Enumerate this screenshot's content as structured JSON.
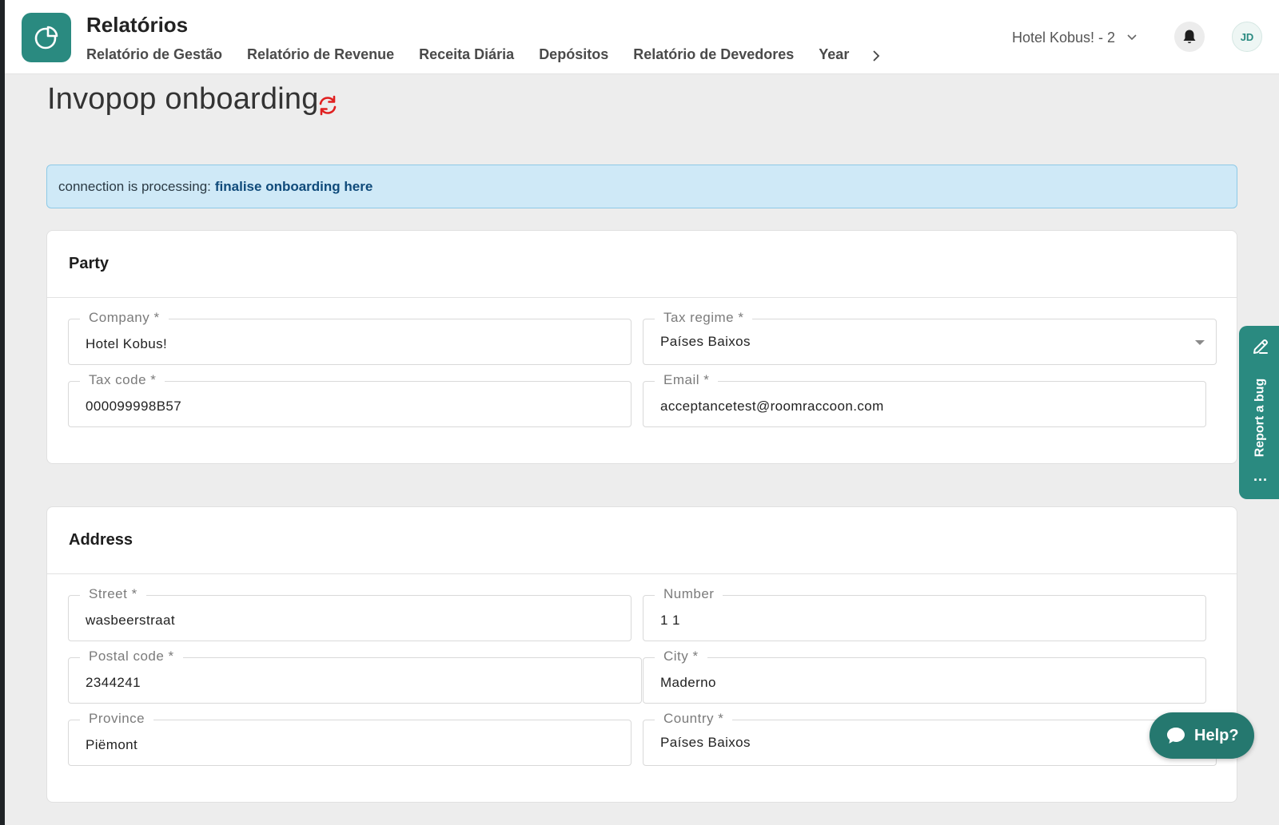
{
  "header": {
    "title": "Relatórios",
    "nav_tabs": [
      {
        "label": "Relatório de Gestão"
      },
      {
        "label": "Relatório de Revenue"
      },
      {
        "label": "Receita Diária"
      },
      {
        "label": "Depósitos"
      },
      {
        "label": "Relatório de Devedores"
      },
      {
        "label": "Year"
      }
    ],
    "hotel_selector": "Hotel Kobus! - 2",
    "avatar_initials": "JD",
    "accent_color": "#2a8a80"
  },
  "page": {
    "title": "Invopop onboarding"
  },
  "alert": {
    "text": "connection is processing:",
    "link_label": "finalise onboarding here"
  },
  "party": {
    "heading": "Party",
    "company": {
      "label": "Company *",
      "value": "Hotel Kobus!"
    },
    "tax_regime": {
      "label": "Tax regime *",
      "value": "Países Baixos"
    },
    "tax_code": {
      "label": "Tax code *",
      "value": "000099998B57"
    },
    "email": {
      "label": "Email *",
      "value": "acceptancetest@roomraccoon.com"
    }
  },
  "address": {
    "heading": "Address",
    "street": {
      "label": "Street *",
      "value": "wasbeerstraat"
    },
    "number": {
      "label": "Number",
      "value": "1 1"
    },
    "postal_code": {
      "label": "Postal code *",
      "value": "2344241"
    },
    "city": {
      "label": "City *",
      "value": "Maderno"
    },
    "province": {
      "label": "Province",
      "value": "Piëmont"
    },
    "country": {
      "label": "Country *",
      "value": "Países Baixos"
    }
  },
  "widgets": {
    "report_bug": "Report a bug",
    "report_bug_more": "...",
    "help": "Help?"
  }
}
